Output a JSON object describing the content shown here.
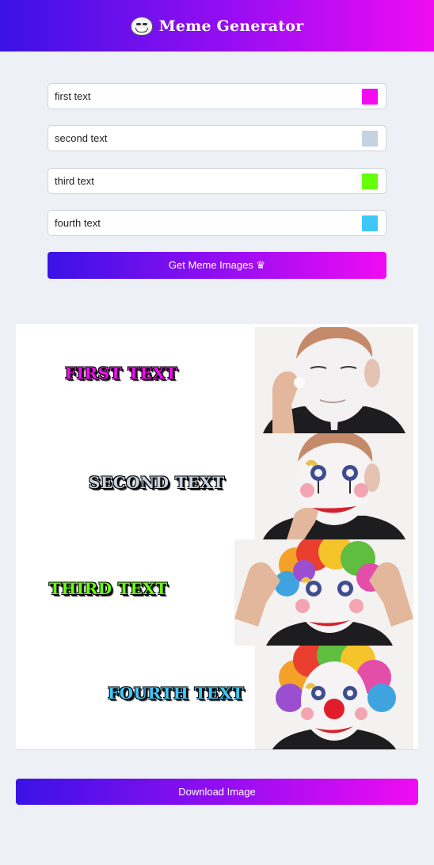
{
  "header": {
    "title": "Meme Generator",
    "logo_icon": "troll-face-icon"
  },
  "fields": [
    {
      "value": "first text",
      "color": "#f30cf2"
    },
    {
      "value": "second text",
      "color": "#c6d1e1"
    },
    {
      "value": "third text",
      "color": "#66ff0a"
    },
    {
      "value": "fourth text",
      "color": "#3ec8f8"
    }
  ],
  "generate_button": {
    "label": "Get Meme Images ♛"
  },
  "meme": {
    "captions": [
      {
        "text": "FIRST TEXT",
        "color": "#f30cf2"
      },
      {
        "text": "SECOND TEXT",
        "color": "#c6d1e1"
      },
      {
        "text": "THIRD TEXT",
        "color": "#66ff0a"
      },
      {
        "text": "FOURTH TEXT",
        "color": "#3ec8f8"
      }
    ]
  },
  "download_button": {
    "label": "Download Image"
  }
}
